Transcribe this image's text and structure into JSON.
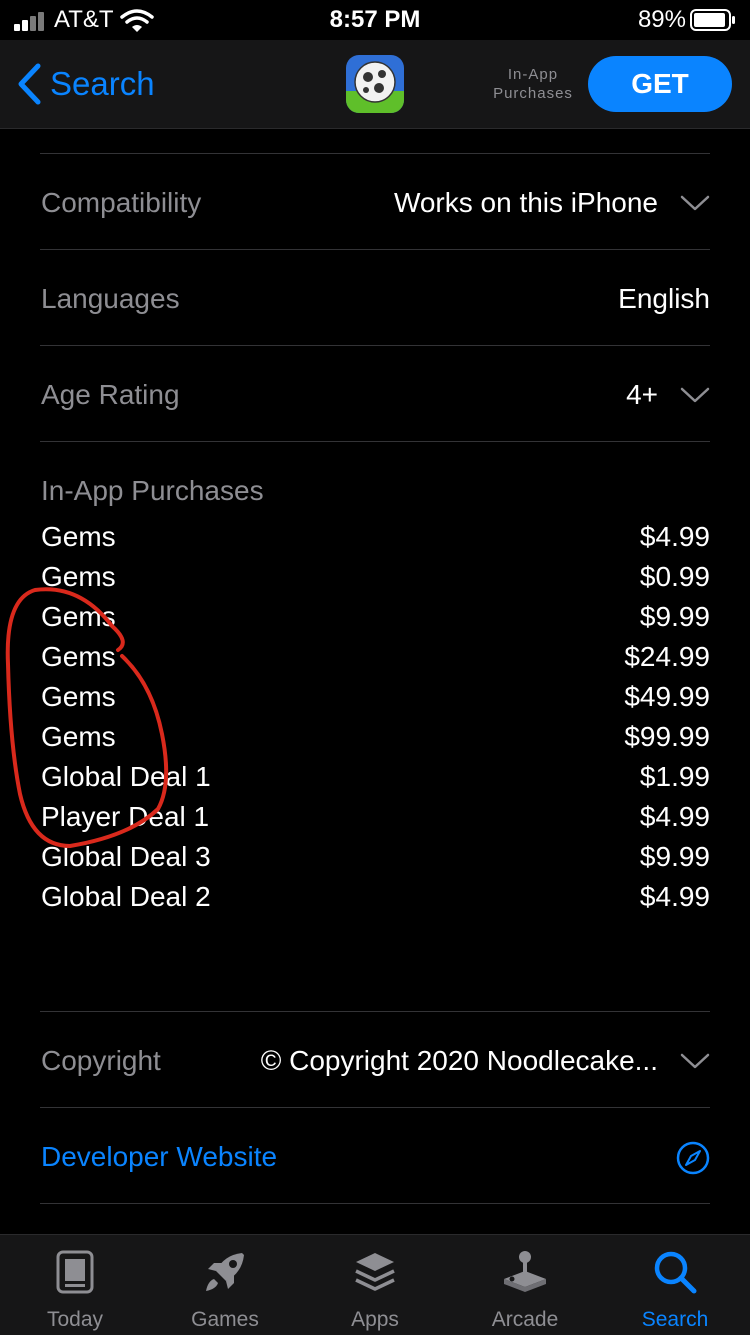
{
  "status_bar": {
    "carrier": "AT&T",
    "time": "8:57 PM",
    "battery": "89%"
  },
  "nav": {
    "back_label": "Search",
    "iap_note": "In-App\nPurchases",
    "get_label": "GET"
  },
  "info_rows": {
    "compatibility": {
      "label": "Compatibility",
      "value": "Works on this iPhone"
    },
    "languages": {
      "label": "Languages",
      "value": "English"
    },
    "age_rating": {
      "label": "Age Rating",
      "value": "4+"
    }
  },
  "in_app_purchases": {
    "title": "In-App Purchases",
    "items": [
      {
        "name": "Gems",
        "price": "$4.99"
      },
      {
        "name": "Gems",
        "price": "$0.99"
      },
      {
        "name": "Gems",
        "price": "$9.99"
      },
      {
        "name": "Gems",
        "price": "$24.99"
      },
      {
        "name": "Gems",
        "price": "$49.99"
      },
      {
        "name": "Gems",
        "price": "$99.99"
      },
      {
        "name": "Global Deal 1",
        "price": "$1.99"
      },
      {
        "name": "Player Deal 1",
        "price": "$4.99"
      },
      {
        "name": "Global Deal 3",
        "price": "$9.99"
      },
      {
        "name": "Global Deal 2",
        "price": "$4.99"
      }
    ]
  },
  "copyright": {
    "label": "Copyright",
    "value": "© Copyright 2020 Noodlecake..."
  },
  "developer_website": {
    "label": "Developer Website"
  },
  "tabs": [
    {
      "label": "Today",
      "icon": "today-icon"
    },
    {
      "label": "Games",
      "icon": "rocket-icon"
    },
    {
      "label": "Apps",
      "icon": "layers-icon"
    },
    {
      "label": "Arcade",
      "icon": "joystick-icon"
    },
    {
      "label": "Search",
      "icon": "search-icon",
      "active": true
    }
  ],
  "colors": {
    "accent": "#0a84ff",
    "background": "#000000",
    "secondary_text": "#8e8e93",
    "annotation": "#d9291c"
  }
}
